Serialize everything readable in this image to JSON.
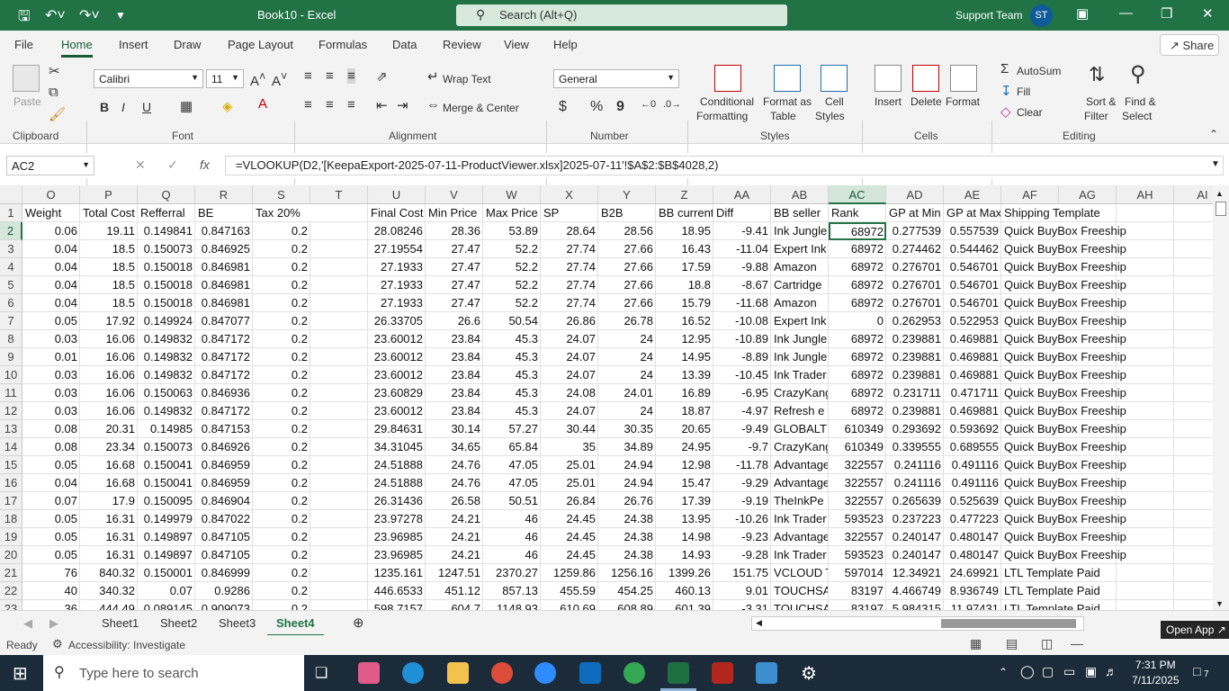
{
  "window": {
    "title": "Book10  -  Excel",
    "search_placeholder": "Search (Alt+Q)",
    "user_name": "Support Team",
    "user_initials": "ST"
  },
  "menu": {
    "tabs": [
      "File",
      "Home",
      "Insert",
      "Draw",
      "Page Layout",
      "Formulas",
      "Data",
      "Review",
      "View",
      "Help"
    ],
    "active": "Home",
    "share_label": "Share"
  },
  "ribbon": {
    "clipboard": {
      "group": "Clipboard",
      "paste": "Paste"
    },
    "font": {
      "group": "Font",
      "name": "Calibri",
      "size": "11",
      "bold": "B",
      "italic": "I",
      "underline": "U"
    },
    "alignment": {
      "group": "Alignment",
      "wrap_text": "Wrap Text",
      "merge_center": "Merge & Center"
    },
    "number": {
      "group": "Number",
      "format": "General",
      "currency": "$",
      "percent": "%",
      "comma": "9"
    },
    "styles": {
      "group": "Styles",
      "conditional": [
        "Conditional",
        "Formatting"
      ],
      "format_table": [
        "Format as",
        "Table"
      ],
      "cell_styles": [
        "Cell",
        "Styles"
      ]
    },
    "cells": {
      "group": "Cells",
      "insert": "Insert",
      "delete": "Delete",
      "format": "Format"
    },
    "editing": {
      "group": "Editing",
      "autosum": "AutoSum",
      "fill": "Fill",
      "clear": "Clear",
      "sort_filter": [
        "Sort &",
        "Filter"
      ],
      "find_select": [
        "Find &",
        "Select"
      ]
    }
  },
  "formula_bar": {
    "name_box": "AC2",
    "formula": "=VLOOKUP(D2,'[KeepaExport-2025-07-11-ProductViewer.xlsx]2025-07-11'!$A$2:$B$4028,2)"
  },
  "columns": [
    "O",
    "P",
    "Q",
    "R",
    "S",
    "T",
    "U",
    "V",
    "W",
    "X",
    "Y",
    "Z",
    "AA",
    "AB",
    "AC",
    "AD",
    "AE",
    "AF",
    "AG",
    "AH",
    "AI"
  ],
  "rows": [
    {
      "n": "1",
      "c": [
        "Weight",
        "Total Cost",
        "Refferral",
        "BE",
        "Tax 20%",
        "",
        "Final Cost",
        "Min Price",
        "Max Price",
        "SP",
        "B2B",
        "BB current",
        "Diff",
        "BB seller",
        "Rank",
        "GP at Min",
        "GP at Max",
        "Shipping Template",
        "",
        "",
        ""
      ]
    },
    {
      "n": "2",
      "c": [
        "0.06",
        "19.11",
        "0.149841",
        "0.847163",
        "0.2",
        "",
        "28.08246",
        "28.36",
        "53.89",
        "28.64",
        "28.56",
        "18.95",
        "-9.41",
        "Ink Jungle",
        "68972",
        "0.277539",
        "0.557539",
        "Quick BuyBox Freeship",
        "",
        "",
        ""
      ]
    },
    {
      "n": "3",
      "c": [
        "0.04",
        "18.5",
        "0.150073",
        "0.846925",
        "0.2",
        "",
        "27.19554",
        "27.47",
        "52.2",
        "27.74",
        "27.66",
        "16.43",
        "-11.04",
        "Expert Ink",
        "68972",
        "0.274462",
        "0.544462",
        "Quick BuyBox Freeship",
        "",
        "",
        ""
      ]
    },
    {
      "n": "4",
      "c": [
        "0.04",
        "18.5",
        "0.150018",
        "0.846981",
        "0.2",
        "",
        "27.1933",
        "27.47",
        "52.2",
        "27.74",
        "27.66",
        "17.59",
        "-9.88",
        "Amazon",
        "68972",
        "0.276701",
        "0.546701",
        "Quick BuyBox Freeship",
        "",
        "",
        ""
      ]
    },
    {
      "n": "5",
      "c": [
        "0.04",
        "18.5",
        "0.150018",
        "0.846981",
        "0.2",
        "",
        "27.1933",
        "27.47",
        "52.2",
        "27.74",
        "27.66",
        "18.8",
        "-8.67",
        "Cartridge",
        "68972",
        "0.276701",
        "0.546701",
        "Quick BuyBox Freeship",
        "",
        "",
        ""
      ]
    },
    {
      "n": "6",
      "c": [
        "0.04",
        "18.5",
        "0.150018",
        "0.846981",
        "0.2",
        "",
        "27.1933",
        "27.47",
        "52.2",
        "27.74",
        "27.66",
        "15.79",
        "-11.68",
        "Amazon",
        "68972",
        "0.276701",
        "0.546701",
        "Quick BuyBox Freeship",
        "",
        "",
        ""
      ]
    },
    {
      "n": "7",
      "c": [
        "0.05",
        "17.92",
        "0.149924",
        "0.847077",
        "0.2",
        "",
        "26.33705",
        "26.6",
        "50.54",
        "26.86",
        "26.78",
        "16.52",
        "-10.08",
        "Expert Ink",
        "0",
        "0.262953",
        "0.522953",
        "Quick BuyBox Freeship",
        "",
        "",
        ""
      ]
    },
    {
      "n": "8",
      "c": [
        "0.03",
        "16.06",
        "0.149832",
        "0.847172",
        "0.2",
        "",
        "23.60012",
        "23.84",
        "45.3",
        "24.07",
        "24",
        "12.95",
        "-10.89",
        "Ink Jungle",
        "68972",
        "0.239881",
        "0.469881",
        "Quick BuyBox Freeship",
        "",
        "",
        ""
      ]
    },
    {
      "n": "9",
      "c": [
        "0.01",
        "16.06",
        "0.149832",
        "0.847172",
        "0.2",
        "",
        "23.60012",
        "23.84",
        "45.3",
        "24.07",
        "24",
        "14.95",
        "-8.89",
        "Ink Jungle",
        "68972",
        "0.239881",
        "0.469881",
        "Quick BuyBox Freeship",
        "",
        "",
        ""
      ]
    },
    {
      "n": "10",
      "c": [
        "0.03",
        "16.06",
        "0.149832",
        "0.847172",
        "0.2",
        "",
        "23.60012",
        "23.84",
        "45.3",
        "24.07",
        "24",
        "13.39",
        "-10.45",
        "Ink Trader",
        "68972",
        "0.239881",
        "0.469881",
        "Quick BuyBox Freeship",
        "",
        "",
        ""
      ]
    },
    {
      "n": "11",
      "c": [
        "0.03",
        "16.06",
        "0.150063",
        "0.846936",
        "0.2",
        "",
        "23.60829",
        "23.84",
        "45.3",
        "24.08",
        "24.01",
        "16.89",
        "-6.95",
        "CrazyKang",
        "68972",
        "0.231711",
        "0.471711",
        "Quick BuyBox Freeship",
        "",
        "",
        ""
      ]
    },
    {
      "n": "12",
      "c": [
        "0.03",
        "16.06",
        "0.149832",
        "0.847172",
        "0.2",
        "",
        "23.60012",
        "23.84",
        "45.3",
        "24.07",
        "24",
        "18.87",
        "-4.97",
        "Refresh e",
        "68972",
        "0.239881",
        "0.469881",
        "Quick BuyBox Freeship",
        "",
        "",
        ""
      ]
    },
    {
      "n": "13",
      "c": [
        "0.08",
        "20.31",
        "0.14985",
        "0.847153",
        "0.2",
        "",
        "29.84631",
        "30.14",
        "57.27",
        "30.44",
        "30.35",
        "20.65",
        "-9.49",
        "GLOBALTE",
        "610349",
        "0.293692",
        "0.593692",
        "Quick BuyBox Freeship",
        "",
        "",
        ""
      ]
    },
    {
      "n": "14",
      "c": [
        "0.08",
        "23.34",
        "0.150073",
        "0.846926",
        "0.2",
        "",
        "34.31045",
        "34.65",
        "65.84",
        "35",
        "34.89",
        "24.95",
        "-9.7",
        "CrazyKang",
        "610349",
        "0.339555",
        "0.689555",
        "Quick BuyBox Freeship",
        "",
        "",
        ""
      ]
    },
    {
      "n": "15",
      "c": [
        "0.05",
        "16.68",
        "0.150041",
        "0.846959",
        "0.2",
        "",
        "24.51888",
        "24.76",
        "47.05",
        "25.01",
        "24.94",
        "12.98",
        "-11.78",
        "Advantage",
        "322557",
        "0.241116",
        "0.491116",
        "Quick BuyBox Freeship",
        "",
        "",
        ""
      ]
    },
    {
      "n": "16",
      "c": [
        "0.04",
        "16.68",
        "0.150041",
        "0.846959",
        "0.2",
        "",
        "24.51888",
        "24.76",
        "47.05",
        "25.01",
        "24.94",
        "15.47",
        "-9.29",
        "Advantage",
        "322557",
        "0.241116",
        "0.491116",
        "Quick BuyBox Freeship",
        "",
        "",
        ""
      ]
    },
    {
      "n": "17",
      "c": [
        "0.07",
        "17.9",
        "0.150095",
        "0.846904",
        "0.2",
        "",
        "26.31436",
        "26.58",
        "50.51",
        "26.84",
        "26.76",
        "17.39",
        "-9.19",
        "TheInkPe",
        "322557",
        "0.265639",
        "0.525639",
        "Quick BuyBox Freeship",
        "",
        "",
        ""
      ]
    },
    {
      "n": "18",
      "c": [
        "0.05",
        "16.31",
        "0.149979",
        "0.847022",
        "0.2",
        "",
        "23.97278",
        "24.21",
        "46",
        "24.45",
        "24.38",
        "13.95",
        "-10.26",
        "Ink Trader",
        "593523",
        "0.237223",
        "0.477223",
        "Quick BuyBox Freeship",
        "",
        "",
        ""
      ]
    },
    {
      "n": "19",
      "c": [
        "0.05",
        "16.31",
        "0.149897",
        "0.847105",
        "0.2",
        "",
        "23.96985",
        "24.21",
        "46",
        "24.45",
        "24.38",
        "14.98",
        "-9.23",
        "Advantage",
        "322557",
        "0.240147",
        "0.480147",
        "Quick BuyBox Freeship",
        "",
        "",
        ""
      ]
    },
    {
      "n": "20",
      "c": [
        "0.05",
        "16.31",
        "0.149897",
        "0.847105",
        "0.2",
        "",
        "23.96985",
        "24.21",
        "46",
        "24.45",
        "24.38",
        "14.93",
        "-9.28",
        "Ink Trader",
        "593523",
        "0.240147",
        "0.480147",
        "Quick BuyBox Freeship",
        "",
        "",
        ""
      ]
    },
    {
      "n": "21",
      "c": [
        "76",
        "840.32",
        "0.150001",
        "0.846999",
        "0.2",
        "",
        "1235.161",
        "1247.51",
        "2370.27",
        "1259.86",
        "1256.16",
        "1399.26",
        "151.75",
        "VCLOUD T",
        "597014",
        "12.34921",
        "24.69921",
        "LTL Template Paid",
        "",
        "",
        ""
      ]
    },
    {
      "n": "22",
      "c": [
        "40",
        "340.32",
        "0.07",
        "0.9286",
        "0.2",
        "",
        "446.6533",
        "451.12",
        "857.13",
        "455.59",
        "454.25",
        "460.13",
        "9.01",
        "TOUCHSAI",
        "83197",
        "4.466749",
        "8.936749",
        "LTL Template Paid",
        "",
        "",
        ""
      ]
    },
    {
      "n": "23",
      "c": [
        "36",
        "444.49",
        "0.089145",
        "0.909073",
        "0.2",
        "",
        "598.7157",
        "604.7",
        "1148.93",
        "610.69",
        "608.89",
        "601.39",
        "-3.31",
        "TOUCHSAI",
        "83197",
        "5.984315",
        "11.97431",
        "LTL Template Paid",
        "",
        "",
        ""
      ]
    }
  ],
  "sheets": {
    "tabs": [
      "Sheet1",
      "Sheet2",
      "Sheet3",
      "Sheet4"
    ],
    "active": "Sheet4"
  },
  "status": {
    "ready": "Ready",
    "accessibility": "Accessibility: Investigate",
    "open_app": "Open App"
  },
  "taskbar": {
    "search_placeholder": "Type here to search",
    "time": "7:31 PM",
    "date": "7/11/2025",
    "notifications": "7"
  }
}
